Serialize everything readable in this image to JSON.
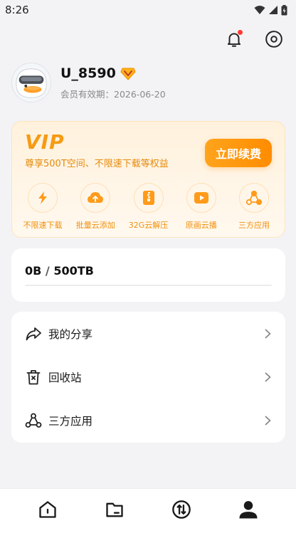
{
  "status_bar": {
    "time": "8:26"
  },
  "profile": {
    "username": "U_8590",
    "expiry": "会员有效期：2026-06-20"
  },
  "vip": {
    "title": "VIP",
    "description": "尊享500T空间、不限速下载等权益",
    "renew_label": "立即续费",
    "features": [
      {
        "label": "不限速下载",
        "icon": "lightning-icon"
      },
      {
        "label": "批量云添加",
        "icon": "cloud-upload-icon"
      },
      {
        "label": "32G云解压",
        "icon": "zip-file-icon"
      },
      {
        "label": "原画云播",
        "icon": "play-icon"
      },
      {
        "label": "三方应用",
        "icon": "connections-icon"
      }
    ]
  },
  "storage": {
    "used": "0B",
    "separator": "/",
    "total": "500TB",
    "usage_fraction": 0
  },
  "menu": {
    "items": [
      {
        "label": "我的分享",
        "icon": "share-icon"
      },
      {
        "label": "回收站",
        "icon": "trash-icon"
      },
      {
        "label": "三方应用",
        "icon": "connections-icon"
      }
    ]
  },
  "bottom_nav": {
    "items": [
      {
        "icon": "home-icon"
      },
      {
        "icon": "folder-icon"
      },
      {
        "icon": "transfer-icon"
      },
      {
        "icon": "profile-icon"
      }
    ]
  },
  "colors": {
    "accent": "#ff9b1a",
    "vip_text": "#f0900e",
    "notification_dot": "#ff3b30"
  }
}
